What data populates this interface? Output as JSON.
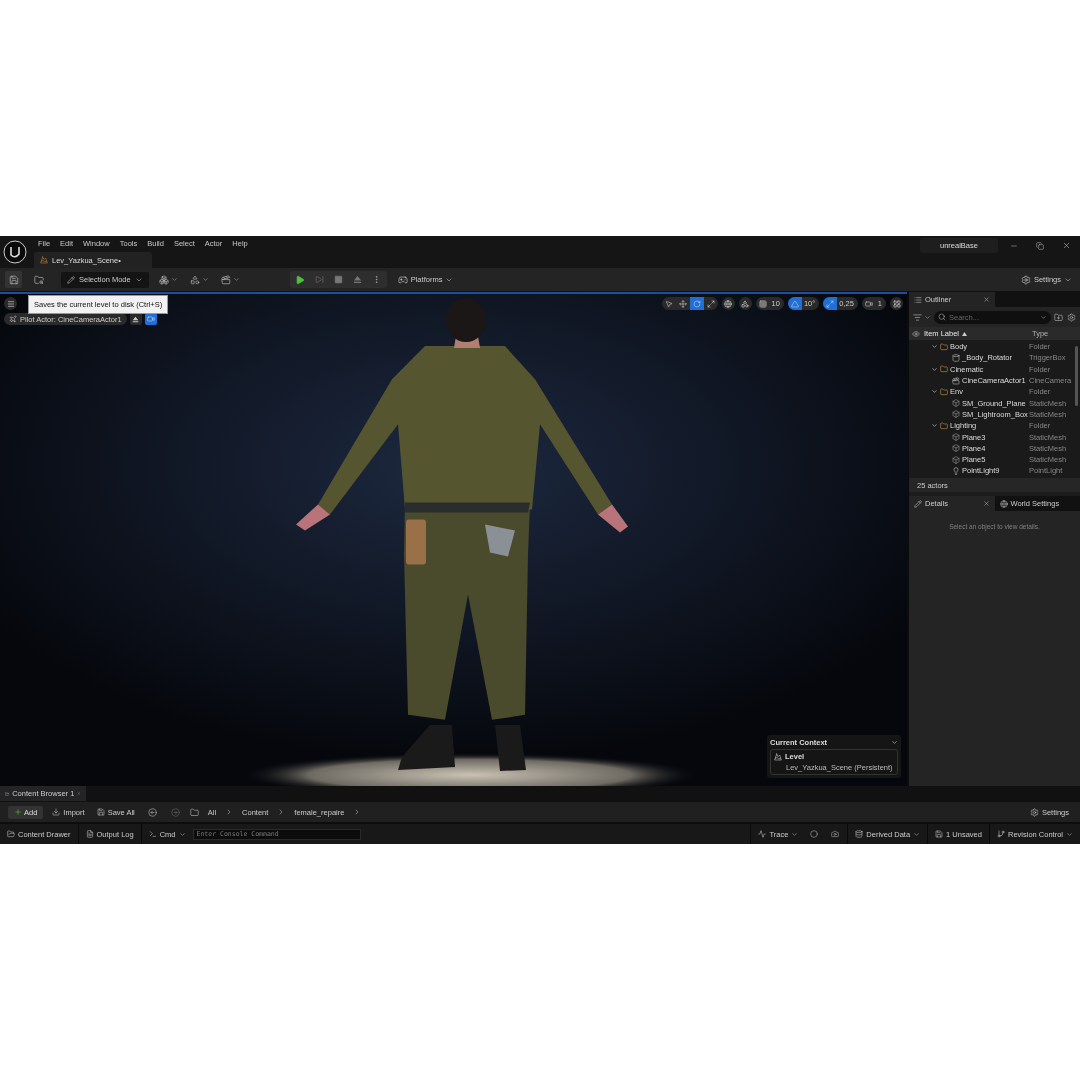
{
  "app": {
    "menu": [
      "File",
      "Edit",
      "Window",
      "Tools",
      "Build",
      "Select",
      "Actor",
      "Help"
    ],
    "level_tab": "Lev_Yazkua_Scene•",
    "project": "unrealBase"
  },
  "toolbar": {
    "mode": "Selection Mode",
    "platforms": "Platforms",
    "settings": "Settings"
  },
  "tooltip": "Saves the current level to disk (Ctrl+S)",
  "viewport": {
    "pilot": "Pilot Actor: CineCameraActor1",
    "tools": [
      {
        "kind": "select",
        "selected": false
      },
      {
        "kind": "move",
        "selected": false
      },
      {
        "kind": "rotate",
        "selected": true
      },
      {
        "kind": "scale",
        "selected": false
      }
    ],
    "snaps": [
      {
        "kind": "grid",
        "value": "10",
        "on": false
      },
      {
        "kind": "angle",
        "value": "10°",
        "on": true
      },
      {
        "kind": "scale",
        "value": "0,25",
        "on": true
      },
      {
        "kind": "camera",
        "value": "1",
        "on": false
      }
    ],
    "context": {
      "title": "Current Context",
      "label": "Level",
      "value": "Lev_Yazkua_Scene (Persistent)"
    }
  },
  "outliner": {
    "title": "Outliner",
    "search": {
      "placeholder": "Search..."
    },
    "columns": [
      {
        "label": "Item Label",
        "sorted": true
      },
      {
        "label": "Type",
        "sorted": false
      }
    ],
    "items": [
      {
        "kind": "folder",
        "label": "Body",
        "type": "Folder",
        "expanded": true,
        "children": [
          {
            "kind": "trigger",
            "label": "_Body_Rotator",
            "type": "TriggerBox"
          }
        ]
      },
      {
        "kind": "folder",
        "label": "Cinematic",
        "type": "Folder",
        "expanded": true,
        "children": [
          {
            "kind": "camera",
            "label": "CineCameraActor1",
            "type": "CineCamera"
          }
        ]
      },
      {
        "kind": "folder",
        "label": "Env",
        "type": "Folder",
        "expanded": true,
        "children": [
          {
            "kind": "mesh",
            "label": "SM_Ground_Plane",
            "type": "StaticMesh"
          },
          {
            "kind": "mesh",
            "label": "SM_Lightroom_Box",
            "type": "StaticMesh"
          }
        ]
      },
      {
        "kind": "folder",
        "label": "Lighting",
        "type": "Folder",
        "expanded": true,
        "children": [
          {
            "kind": "mesh",
            "label": "Plane3",
            "type": "StaticMesh"
          },
          {
            "kind": "mesh",
            "label": "Plane4",
            "type": "StaticMesh"
          },
          {
            "kind": "mesh",
            "label": "Plane5",
            "type": "StaticMesh"
          },
          {
            "kind": "light",
            "label": "PointLight9",
            "type": "PointLight"
          }
        ]
      }
    ],
    "count": "25 actors"
  },
  "details": {
    "tabs": [
      {
        "label": "Details",
        "selected": true
      },
      {
        "label": "World Settings",
        "selected": false
      }
    ],
    "empty": "Select an object to view details."
  },
  "content_browser": {
    "tab": "Content Browser 1",
    "buttons": [
      "Add",
      "Import",
      "Save All"
    ],
    "path": [
      "All",
      "Content",
      "female_repaire"
    ],
    "settings": "Settings"
  },
  "status_bar": {
    "content_drawer": "Content Drawer",
    "output_log": "Output Log",
    "cmd": "Cmd",
    "console": {
      "placeholder": "Enter Console Command"
    },
    "trace": "Trace",
    "derived_data": "Derived Data",
    "unsaved": "1 Unsaved",
    "revision": "Revision Control"
  }
}
